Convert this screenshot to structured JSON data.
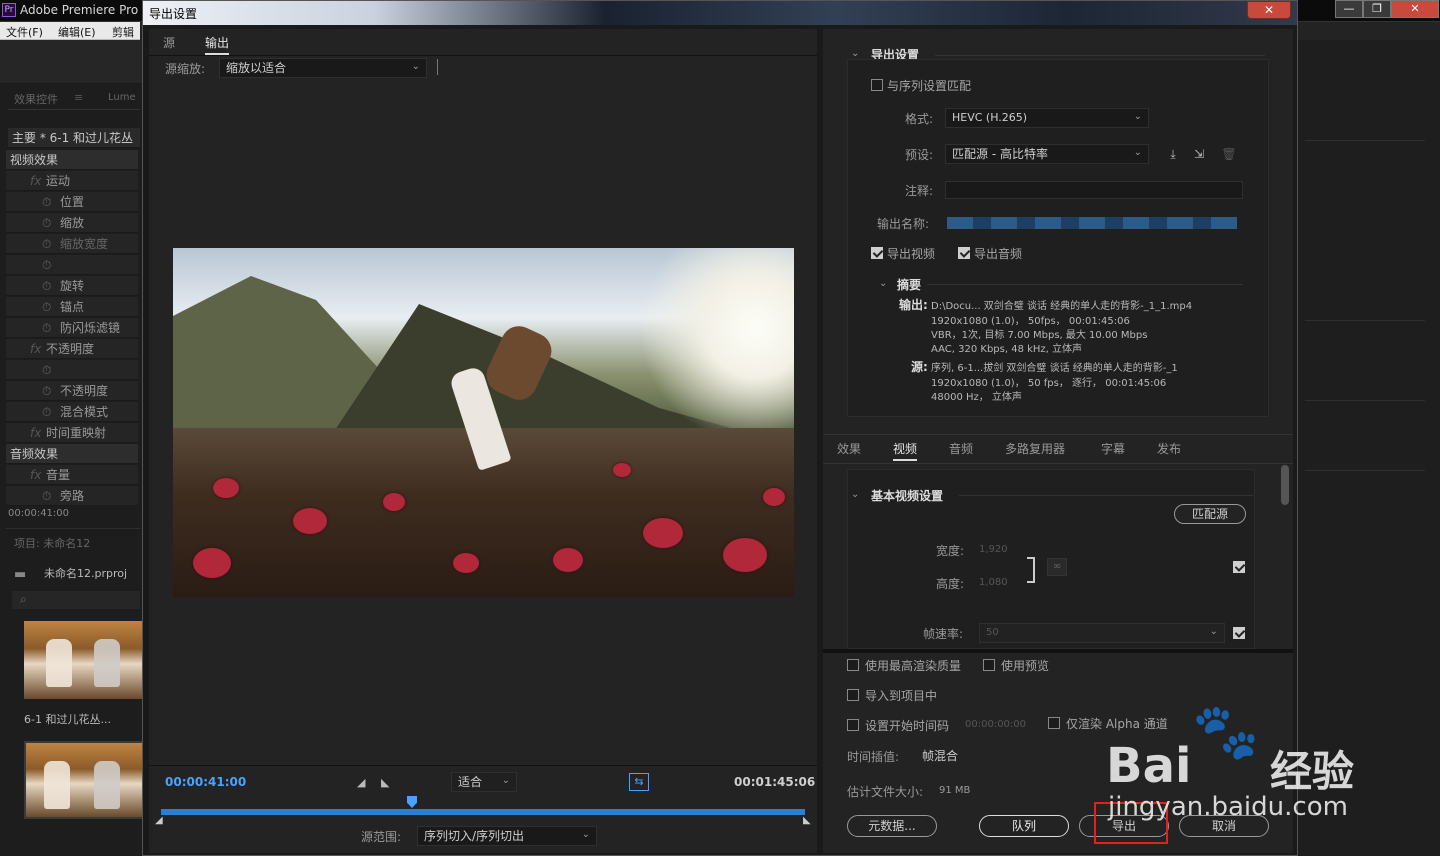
{
  "background_app": {
    "title": "Adobe Premiere Pro",
    "menu": [
      "文件(F)",
      "编辑(E)",
      "剪辑"
    ],
    "window_buttons": [
      "—",
      "❐",
      "✕"
    ],
    "left_panel": {
      "tabs": [
        "效果控件",
        "Lume"
      ],
      "clip_header": "主要 * 6-1  和过儿花丛",
      "rows": [
        {
          "label": "视频效果",
          "kind": "head"
        },
        {
          "label": "运动",
          "kind": "fx"
        },
        {
          "label": "位置",
          "kind": "prop"
        },
        {
          "label": "缩放",
          "kind": "prop"
        },
        {
          "label": "缩放宽度",
          "kind": "dim"
        },
        {
          "label": "",
          "kind": "prop"
        },
        {
          "label": "旋转",
          "kind": "prop"
        },
        {
          "label": "锚点",
          "kind": "prop"
        },
        {
          "label": "防闪烁滤镜",
          "kind": "prop"
        },
        {
          "label": "不透明度",
          "kind": "fx"
        },
        {
          "label": "",
          "kind": "prop"
        },
        {
          "label": "不透明度",
          "kind": "prop"
        },
        {
          "label": "混合模式",
          "kind": "prop"
        },
        {
          "label": "时间重映射",
          "kind": "fx"
        },
        {
          "label": "音频效果",
          "kind": "head"
        },
        {
          "label": "音量",
          "kind": "fx"
        },
        {
          "label": "旁路",
          "kind": "prop"
        }
      ],
      "timecode": "00:00:41:00",
      "project_title": "项目: 未命名12",
      "project_file": "未命名12.prproj",
      "clip_name": "6-1 和过儿花丛..."
    }
  },
  "dialog": {
    "title": "导出设置",
    "close": "✕",
    "left": {
      "tabs": [
        "源",
        "输出"
      ],
      "source_scale_label": "源缩放:",
      "source_scale_value": "缩放以适合",
      "timecode_in": "00:00:41:00",
      "timecode_out": "00:01:45:06",
      "fit_value": "适合",
      "range_label": "源范围:",
      "range_value": "序列切入/序列切出"
    },
    "export_settings": {
      "section_title": "导出设置",
      "match_sequence": "与序列设置匹配",
      "format_label": "格式:",
      "format_value": "HEVC (H.265)",
      "preset_label": "预设:",
      "preset_value": "匹配源 - 高比特率",
      "comments_label": "注释:",
      "output_name_label": "输出名称:",
      "export_video": "导出视频",
      "export_audio": "导出音频",
      "summary_title": "摘要",
      "output_label": "输出:",
      "output_lines": [
        "D:\\Docu... 双剑合璧  谈话 经典的单人走的背影-_1_1.mp4",
        "1920x1080 (1.0)， 50fps，   00:01:45:06",
        "VBR，1次, 目标 7.00 Mbps, 最大 10.00  Mbps",
        "AAC, 320 Kbps, 48  kHz, 立体声"
      ],
      "source_label": "源:",
      "source_lines": [
        "序列, 6-1...拔剑 双剑合璧  谈话 经典的单人走的背影-_1",
        "1920x1080 (1.0)， 50 fps， 逐行，   00:01:45:06",
        "48000 Hz， 立体声"
      ]
    },
    "tabs2": [
      "效果",
      "视频",
      "音频",
      "多路复用器",
      "字幕",
      "发布"
    ],
    "video": {
      "section_title": "基本视频设置",
      "match_source": "匹配源",
      "width_label": "宽度:",
      "width_value": "1,920",
      "height_label": "高度:",
      "height_value": "1,080",
      "framerate_label": "帧速率:",
      "framerate_value": "50"
    },
    "bottom": {
      "max_render": "使用最高渲染质量",
      "use_previews": "使用预览",
      "import_project": "导入到项目中",
      "set_start_tc": "设置开始时间码",
      "start_tc_value": "00:00:00:00",
      "alpha_only": "仅渲染 Alpha 通道",
      "interp_label": "时间插值:",
      "interp_value": "帧混合",
      "filesize_label": "估计文件大小:",
      "filesize_value": "91 MB",
      "metadata_btn": "元数据...",
      "queue_btn": "队列",
      "export_btn": "导出",
      "cancel_btn": "取消"
    }
  },
  "watermark": {
    "brand": "Bai",
    "brand_tail": "经验",
    "url": "jingyan.baidu.com"
  },
  "colors": {
    "accent": "#2a7fd0",
    "timecode": "#4aa2ff",
    "highlight": "#e2201e"
  }
}
